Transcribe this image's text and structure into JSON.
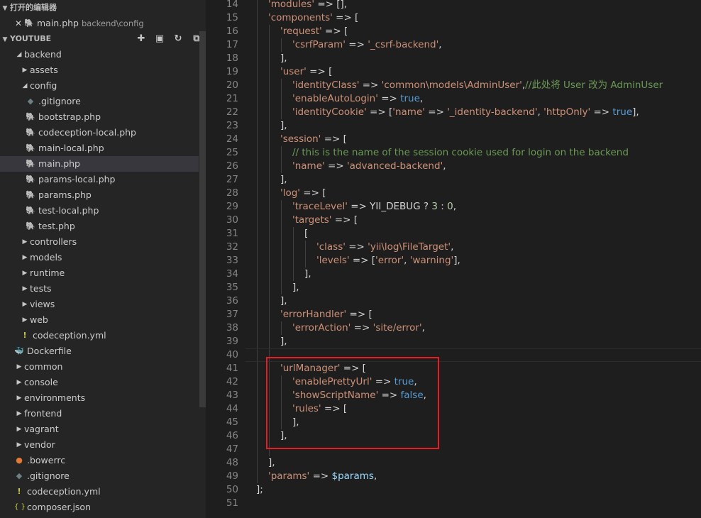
{
  "sidebar": {
    "open_editors_title": "打开的编辑器",
    "open_editor": {
      "name": "main.php",
      "path": "backend\\config"
    },
    "project_title": "YOUTUBE",
    "tree": [
      {
        "label": "backend",
        "kind": "folder",
        "expanded": true,
        "depth": 0
      },
      {
        "label": "assets",
        "kind": "folder",
        "expanded": false,
        "depth": 1
      },
      {
        "label": "config",
        "kind": "folder",
        "expanded": true,
        "depth": 1
      },
      {
        "label": ".gitignore",
        "kind": "git",
        "depth": 2
      },
      {
        "label": "bootstrap.php",
        "kind": "php",
        "depth": 2
      },
      {
        "label": "codeception-local.php",
        "kind": "php",
        "depth": 2
      },
      {
        "label": "main-local.php",
        "kind": "php",
        "depth": 2
      },
      {
        "label": "main.php",
        "kind": "php",
        "depth": 2,
        "active": true
      },
      {
        "label": "params-local.php",
        "kind": "php",
        "depth": 2
      },
      {
        "label": "params.php",
        "kind": "php",
        "depth": 2
      },
      {
        "label": "test-local.php",
        "kind": "php",
        "depth": 2
      },
      {
        "label": "test.php",
        "kind": "php",
        "depth": 2
      },
      {
        "label": "controllers",
        "kind": "folder",
        "expanded": false,
        "depth": 1
      },
      {
        "label": "models",
        "kind": "folder",
        "expanded": false,
        "depth": 1
      },
      {
        "label": "runtime",
        "kind": "folder",
        "expanded": false,
        "depth": 1
      },
      {
        "label": "tests",
        "kind": "folder",
        "expanded": false,
        "depth": 1
      },
      {
        "label": "views",
        "kind": "folder",
        "expanded": false,
        "depth": 1
      },
      {
        "label": "web",
        "kind": "folder",
        "expanded": false,
        "depth": 1
      },
      {
        "label": "codeception.yml",
        "kind": "yml",
        "depth": 1
      },
      {
        "label": "Dockerfile",
        "kind": "docker",
        "depth": 0
      },
      {
        "label": "common",
        "kind": "folder",
        "expanded": false,
        "depth": 0
      },
      {
        "label": "console",
        "kind": "folder",
        "expanded": false,
        "depth": 0
      },
      {
        "label": "environments",
        "kind": "folder",
        "expanded": false,
        "depth": 0
      },
      {
        "label": "frontend",
        "kind": "folder",
        "expanded": false,
        "depth": 0
      },
      {
        "label": "vagrant",
        "kind": "folder",
        "expanded": false,
        "depth": 0
      },
      {
        "label": "vendor",
        "kind": "folder",
        "expanded": false,
        "depth": 0
      },
      {
        "label": ".bowerrc",
        "kind": "bower",
        "depth": 0
      },
      {
        "label": ".gitignore",
        "kind": "git",
        "depth": 0
      },
      {
        "label": "codeception.yml",
        "kind": "yml",
        "depth": 0
      },
      {
        "label": "composer.json",
        "kind": "json",
        "depth": 0
      }
    ]
  },
  "editor": {
    "current_line": 40,
    "lines": [
      {
        "n": "14",
        "indent": 1,
        "tokens": [
          [
            "str",
            "'modules'"
          ],
          [
            "p",
            " => [],"
          ]
        ]
      },
      {
        "n": "15",
        "indent": 1,
        "tokens": [
          [
            "str",
            "'components'"
          ],
          [
            "p",
            " => ["
          ]
        ]
      },
      {
        "n": "16",
        "indent": 2,
        "tokens": [
          [
            "str",
            "'request'"
          ],
          [
            "p",
            " => ["
          ]
        ]
      },
      {
        "n": "17",
        "indent": 3,
        "tokens": [
          [
            "str",
            "'csrfParam'"
          ],
          [
            "p",
            " => "
          ],
          [
            "str",
            "'_csrf-backend'"
          ],
          [
            "p",
            ","
          ]
        ]
      },
      {
        "n": "18",
        "indent": 2,
        "tokens": [
          [
            "p",
            "],"
          ]
        ]
      },
      {
        "n": "19",
        "indent": 2,
        "tokens": [
          [
            "str",
            "'user'"
          ],
          [
            "p",
            " => ["
          ]
        ]
      },
      {
        "n": "20",
        "indent": 3,
        "tokens": [
          [
            "str",
            "'identityClass'"
          ],
          [
            "p",
            " => "
          ],
          [
            "str",
            "'common\\models\\AdminUser'"
          ],
          [
            "p",
            ","
          ],
          [
            "com",
            "//此处将 User 改为 AdminUser"
          ]
        ]
      },
      {
        "n": "21",
        "indent": 3,
        "tokens": [
          [
            "str",
            "'enableAutoLogin'"
          ],
          [
            "p",
            " => "
          ],
          [
            "kw",
            "true"
          ],
          [
            "p",
            ","
          ]
        ]
      },
      {
        "n": "22",
        "indent": 3,
        "tokens": [
          [
            "str",
            "'identityCookie'"
          ],
          [
            "p",
            " => ["
          ],
          [
            "str",
            "'name'"
          ],
          [
            "p",
            " => "
          ],
          [
            "str",
            "'_identity-backend'"
          ],
          [
            "p",
            ", "
          ],
          [
            "str",
            "'httpOnly'"
          ],
          [
            "p",
            " => "
          ],
          [
            "kw",
            "true"
          ],
          [
            "p",
            "],"
          ]
        ]
      },
      {
        "n": "23",
        "indent": 2,
        "tokens": [
          [
            "p",
            "],"
          ]
        ]
      },
      {
        "n": "24",
        "indent": 2,
        "tokens": [
          [
            "str",
            "'session'"
          ],
          [
            "p",
            " => ["
          ]
        ]
      },
      {
        "n": "25",
        "indent": 3,
        "tokens": [
          [
            "com",
            "// this is the name of the session cookie used for login on the backend"
          ]
        ]
      },
      {
        "n": "26",
        "indent": 3,
        "tokens": [
          [
            "str",
            "'name'"
          ],
          [
            "p",
            " => "
          ],
          [
            "str",
            "'advanced-backend'"
          ],
          [
            "p",
            ","
          ]
        ]
      },
      {
        "n": "27",
        "indent": 2,
        "tokens": [
          [
            "p",
            "],"
          ]
        ]
      },
      {
        "n": "28",
        "indent": 2,
        "tokens": [
          [
            "str",
            "'log'"
          ],
          [
            "p",
            " => ["
          ]
        ]
      },
      {
        "n": "29",
        "indent": 3,
        "tokens": [
          [
            "str",
            "'traceLevel'"
          ],
          [
            "p",
            " => YII_DEBUG ? "
          ],
          [
            "num",
            "3"
          ],
          [
            "p",
            " : "
          ],
          [
            "num",
            "0"
          ],
          [
            "p",
            ","
          ]
        ]
      },
      {
        "n": "30",
        "indent": 3,
        "tokens": [
          [
            "str",
            "'targets'"
          ],
          [
            "p",
            " => ["
          ]
        ]
      },
      {
        "n": "31",
        "indent": 4,
        "tokens": [
          [
            "p",
            "["
          ]
        ]
      },
      {
        "n": "32",
        "indent": 5,
        "tokens": [
          [
            "str",
            "'class'"
          ],
          [
            "p",
            " => "
          ],
          [
            "str",
            "'yii\\log\\FileTarget'"
          ],
          [
            "p",
            ","
          ]
        ]
      },
      {
        "n": "33",
        "indent": 5,
        "tokens": [
          [
            "str",
            "'levels'"
          ],
          [
            "p",
            " => ["
          ],
          [
            "str",
            "'error'"
          ],
          [
            "p",
            ", "
          ],
          [
            "str",
            "'warning'"
          ],
          [
            "p",
            "],"
          ]
        ]
      },
      {
        "n": "34",
        "indent": 4,
        "tokens": [
          [
            "p",
            "],"
          ]
        ]
      },
      {
        "n": "35",
        "indent": 3,
        "tokens": [
          [
            "p",
            "],"
          ]
        ]
      },
      {
        "n": "36",
        "indent": 2,
        "tokens": [
          [
            "p",
            "],"
          ]
        ]
      },
      {
        "n": "37",
        "indent": 2,
        "tokens": [
          [
            "str",
            "'errorHandler'"
          ],
          [
            "p",
            " => ["
          ]
        ]
      },
      {
        "n": "38",
        "indent": 3,
        "tokens": [
          [
            "str",
            "'errorAction'"
          ],
          [
            "p",
            " => "
          ],
          [
            "str",
            "'site/error'"
          ],
          [
            "p",
            ","
          ]
        ]
      },
      {
        "n": "39",
        "indent": 2,
        "tokens": [
          [
            "p",
            "],"
          ]
        ]
      },
      {
        "n": "40",
        "indent": 0,
        "tokens": []
      },
      {
        "n": "41",
        "indent": 2,
        "tokens": [
          [
            "str",
            "'urlManager'"
          ],
          [
            "p",
            " => ["
          ]
        ]
      },
      {
        "n": "42",
        "indent": 3,
        "tokens": [
          [
            "str",
            "'enablePrettyUrl'"
          ],
          [
            "p",
            " => "
          ],
          [
            "kw",
            "true"
          ],
          [
            "p",
            ","
          ]
        ]
      },
      {
        "n": "43",
        "indent": 3,
        "tokens": [
          [
            "str",
            "'showScriptName'"
          ],
          [
            "p",
            " => "
          ],
          [
            "kw",
            "false"
          ],
          [
            "p",
            ","
          ]
        ]
      },
      {
        "n": "44",
        "indent": 3,
        "tokens": [
          [
            "str",
            "'rules'"
          ],
          [
            "p",
            " => ["
          ]
        ]
      },
      {
        "n": "45",
        "indent": 3,
        "tokens": [
          [
            "p",
            "],"
          ]
        ]
      },
      {
        "n": "46",
        "indent": 2,
        "tokens": [
          [
            "p",
            "],"
          ]
        ]
      },
      {
        "n": "47",
        "indent": 0,
        "tokens": []
      },
      {
        "n": "48",
        "indent": 1,
        "tokens": [
          [
            "p",
            "],"
          ]
        ]
      },
      {
        "n": "49",
        "indent": 1,
        "tokens": [
          [
            "str",
            "'params'"
          ],
          [
            "p",
            " => "
          ],
          [
            "var",
            "$params"
          ],
          [
            "p",
            ","
          ]
        ]
      },
      {
        "n": "50",
        "indent": 0,
        "tokens": [
          [
            "p",
            "];"
          ]
        ]
      },
      {
        "n": "51",
        "indent": 0,
        "tokens": []
      }
    ]
  },
  "colors": {
    "string": "#ce9178",
    "keyword": "#569cd6",
    "variable": "#9cdcfe",
    "comment": "#6a9955",
    "highlight_box": "#e51e24"
  }
}
